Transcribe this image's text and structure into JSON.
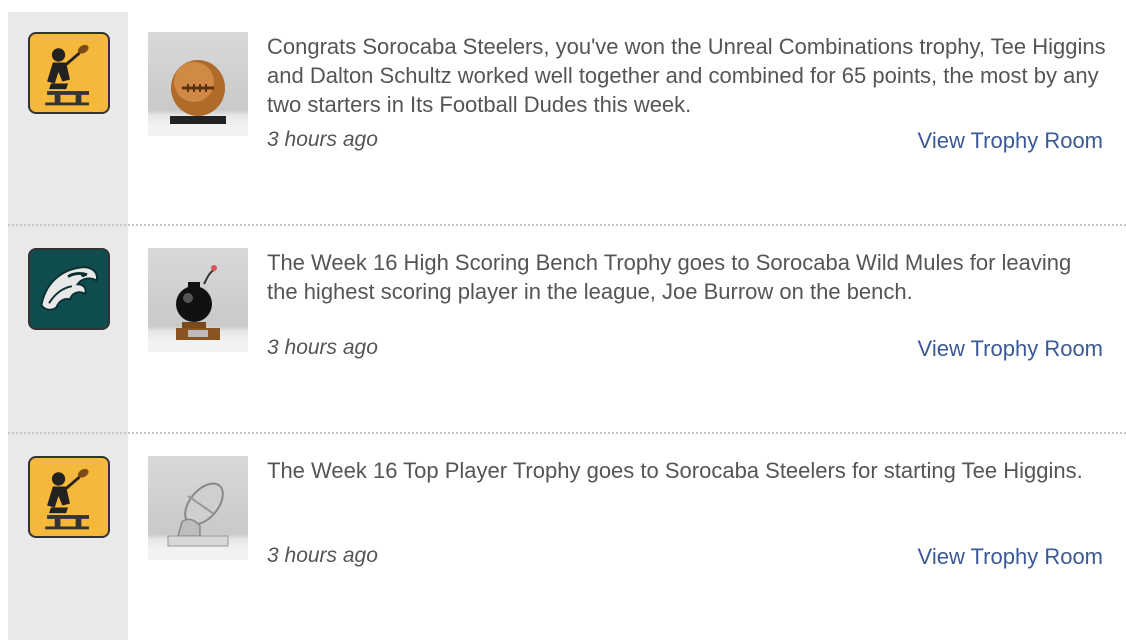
{
  "feed": {
    "items": [
      {
        "team_logo": "steelers-logo",
        "trophy_icon": "football-trophy-icon",
        "message": "Congrats Sorocaba Steelers, you've won the Unreal Combinations trophy, Tee Higgins and Dalton Schultz worked well together and combined for 65 points, the most by any two starters in Its Football Dudes this week.",
        "time": "3 hours ago",
        "link": "View Trophy Room"
      },
      {
        "team_logo": "eagles-logo",
        "trophy_icon": "bomb-trophy-icon",
        "message": "The Week 16 High Scoring Bench Trophy goes to Sorocaba Wild Mules for leaving the highest scoring player in the league, Joe Burrow on the bench.",
        "time": "3 hours ago",
        "link": "View Trophy Room"
      },
      {
        "team_logo": "steelers-logo",
        "trophy_icon": "silver-football-trophy-icon",
        "message": "The Week 16 Top Player Trophy goes to Sorocaba Steelers for starting Tee Higgins.",
        "time": "3 hours ago",
        "link": "View Trophy Room"
      }
    ]
  },
  "colors": {
    "link": "#3b5998",
    "text": "#555555",
    "gutter": "#e9e9e9",
    "steelers_yellow": "#f6b83a",
    "eagles_green": "#0f4d4f"
  }
}
